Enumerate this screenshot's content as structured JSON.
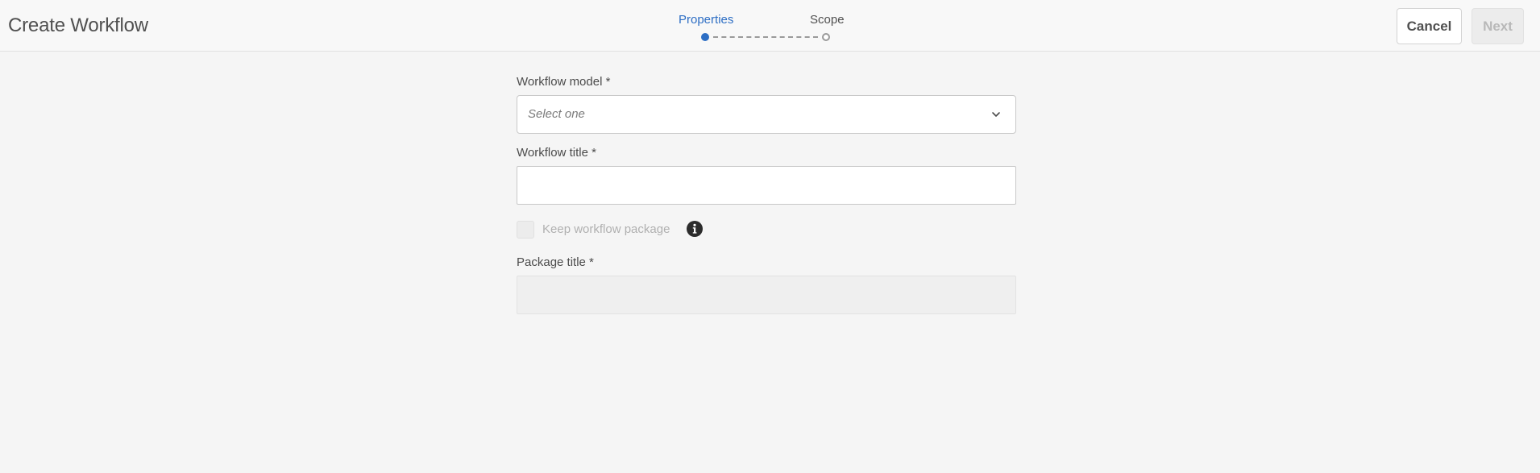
{
  "header": {
    "title": "Create Workflow",
    "cancel_label": "Cancel",
    "next_label": "Next"
  },
  "wizard": {
    "steps": [
      {
        "label": "Properties",
        "state": "active"
      },
      {
        "label": "Scope",
        "state": "inactive"
      }
    ]
  },
  "form": {
    "workflow_model": {
      "label": "Workflow model *",
      "placeholder": "Select one",
      "value": ""
    },
    "workflow_title": {
      "label": "Workflow title *",
      "value": ""
    },
    "keep_package": {
      "label": "Keep workflow package",
      "checked": false,
      "disabled": true
    },
    "package_title": {
      "label": "Package title *",
      "value": "",
      "disabled": true
    }
  },
  "icons": {
    "dropdown": "chevron-down-icon",
    "info": "info-icon"
  },
  "colors": {
    "accent": "#2d6ec4",
    "background": "#f5f5f5"
  }
}
